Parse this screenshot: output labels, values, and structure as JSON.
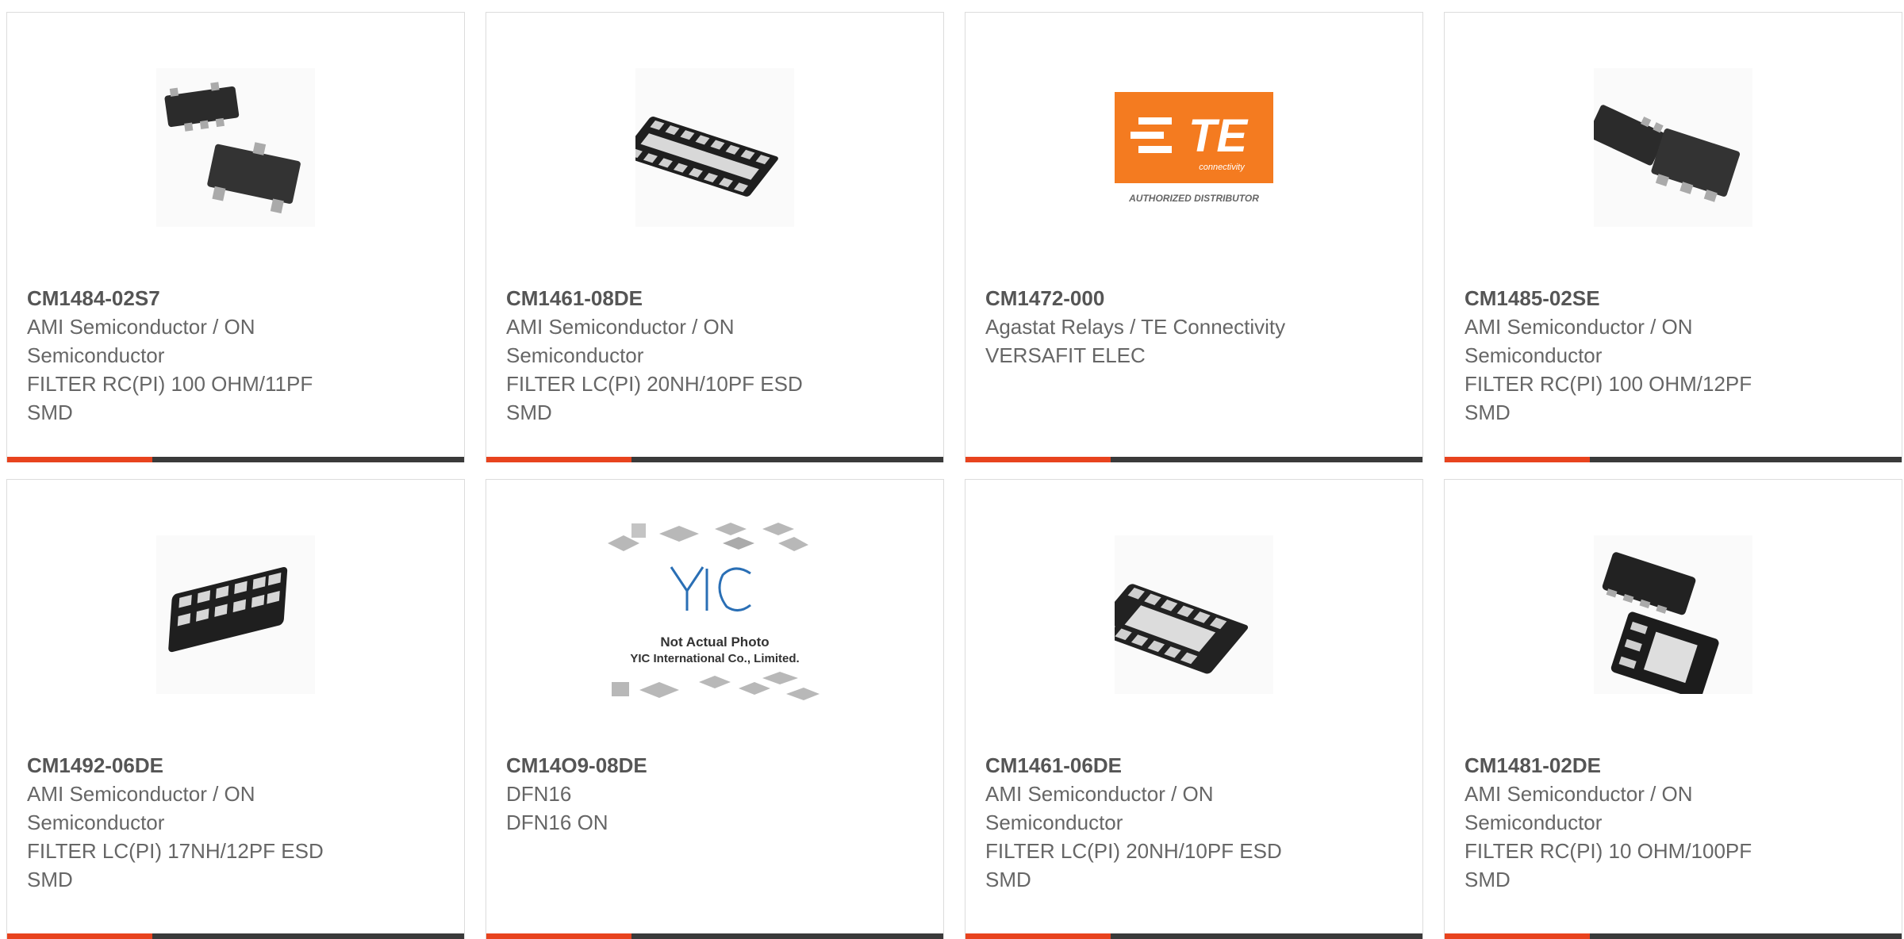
{
  "theme": {
    "accent": "#e8431e",
    "bar": "#3a3a3a",
    "te_orange": "#f47b20"
  },
  "products": [
    {
      "part": "CM1484-02S7",
      "lines": [
        "AMI Semiconductor / ON",
        "Semiconductor",
        "FILTER RC(PI) 100 OHM/11PF",
        "SMD"
      ],
      "image": "sot-package-pair-icon"
    },
    {
      "part": "CM1461-08DE",
      "lines": [
        "AMI Semiconductor / ON",
        "Semiconductor",
        "FILTER LC(PI) 20NH/10PF ESD",
        "SMD"
      ],
      "image": "dfn-16-package-icon"
    },
    {
      "part": "CM1472-000",
      "lines": [
        "Agastat Relays / TE Connectivity",
        "VERSAFIT ELEC"
      ],
      "image": "te-logo",
      "logo": {
        "brand": "TE",
        "sub": "connectivity",
        "tag": "AUTHORIZED DISTRIBUTOR"
      }
    },
    {
      "part": "CM1485-02SE",
      "lines": [
        "AMI Semiconductor / ON",
        "Semiconductor",
        "FILTER RC(PI) 100 OHM/12PF",
        "SMD"
      ],
      "image": "sot-package-pair-icon"
    },
    {
      "part": "CM1492-06DE",
      "lines": [
        "AMI Semiconductor / ON",
        "Semiconductor",
        "FILTER LC(PI) 17NH/12PF ESD",
        "SMD"
      ],
      "image": "dfn-12-package-icon"
    },
    {
      "part": "CM14O9-08DE",
      "lines": [
        "DFN16",
        "DFN16 ON"
      ],
      "image": "yic-placeholder",
      "placeholder": {
        "brand": "YIC",
        "line1": "Not Actual Photo",
        "line2": "YIC International Co., Limited."
      }
    },
    {
      "part": "CM1461-06DE",
      "lines": [
        "AMI Semiconductor / ON",
        "Semiconductor",
        "FILTER LC(PI) 20NH/10PF ESD",
        "SMD"
      ],
      "image": "dfn-12-package-icon"
    },
    {
      "part": "CM1481-02DE",
      "lines": [
        "AMI Semiconductor / ON",
        "Semiconductor",
        "FILTER RC(PI) 10 OHM/100PF",
        "SMD"
      ],
      "image": "dfn-8-package-pair-icon"
    }
  ]
}
